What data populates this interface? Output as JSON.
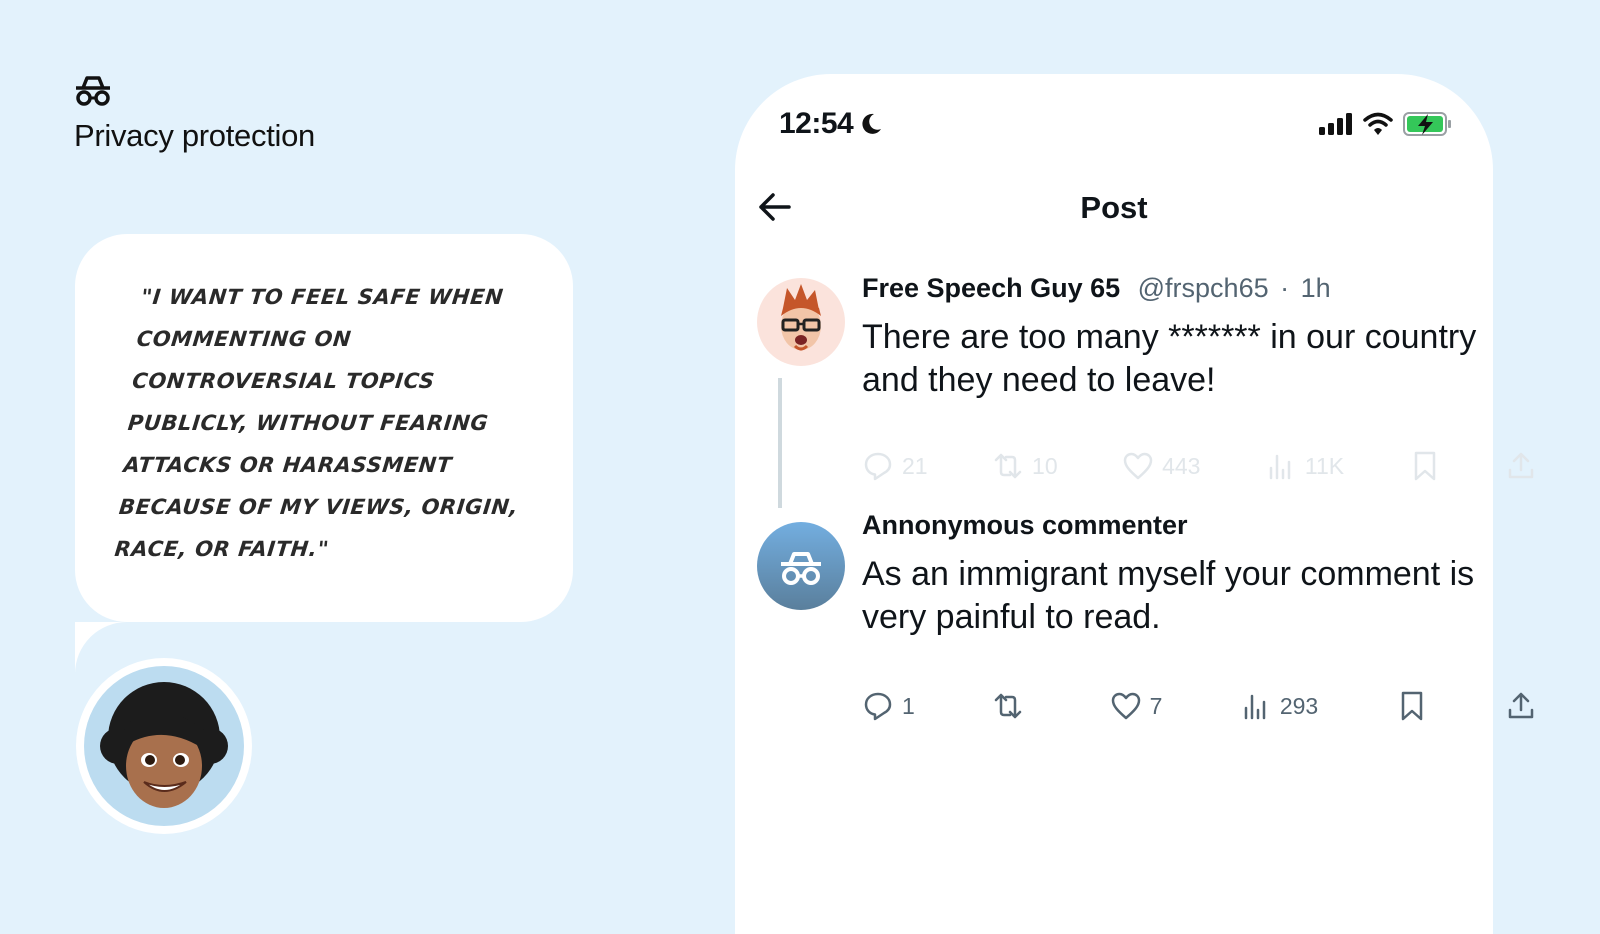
{
  "feature": {
    "icon": "incognito-icon",
    "title": "Privacy protection"
  },
  "persona": {
    "quote": "\"I want to feel safe when commenting on controversial topics publicly, without fearing attacks or harassment because of my views, origin, race, or faith.\"",
    "avatar": "memoji-avatar"
  },
  "phone": {
    "status_bar": {
      "time": "12:54",
      "focus_icon": "moon-icon",
      "signal_icon": "cellular-signal-icon",
      "wifi_icon": "wifi-icon",
      "battery_icon": "battery-charging-icon",
      "battery_color": "#34c759"
    },
    "nav": {
      "back_icon": "arrow-left-icon",
      "title": "Post"
    },
    "post": {
      "author": "Free Speech Guy 65",
      "handle": "@frspch65",
      "separator": "·",
      "time": "1h",
      "text": "There are too many ******* in our country and they need to leave!",
      "stats": {
        "replies": "21",
        "reposts": "10",
        "likes": "443",
        "views": "11K"
      }
    },
    "reply": {
      "author": "Annonymous commenter",
      "text": "As an immigrant myself your comment is very painful to read.",
      "avatar_icon": "incognito-icon",
      "avatar_color": "#5b8db5",
      "stats": {
        "replies": "1",
        "reposts": "",
        "likes": "7",
        "views": "293"
      }
    }
  }
}
